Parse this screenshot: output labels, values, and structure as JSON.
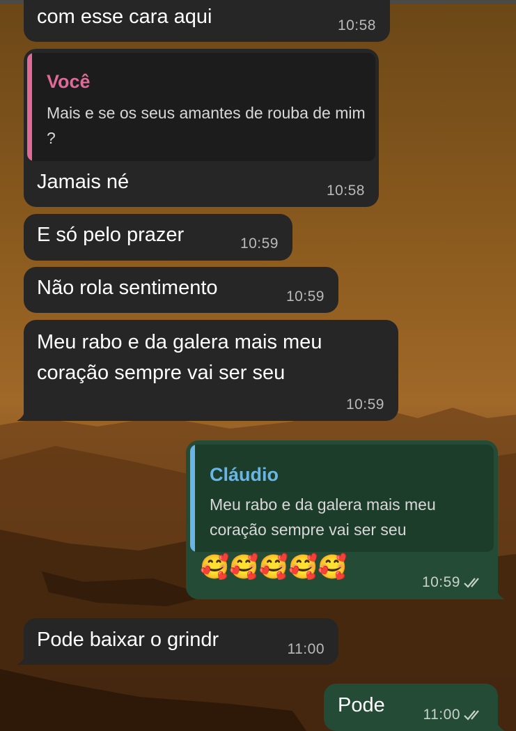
{
  "colors": {
    "incoming_bubble": "#262626",
    "outgoing_bubble": "#234b35",
    "quote_you_accent": "#e06a97",
    "quote_claudio_accent": "#69b6e6"
  },
  "messages": [
    {
      "text": "com esse cara aqui",
      "time": "10:58"
    },
    {
      "reply_to": {
        "name": "Você",
        "text": "Mais e se os seus amantes de rouba de mim ?"
      },
      "text": "Jamais né",
      "time": "10:58"
    },
    {
      "text": "E só pelo prazer",
      "time": "10:59"
    },
    {
      "text": "Não rola sentimento",
      "time": "10:59"
    },
    {
      "text": "Meu rabo e da galera mais meu coração sempre vai ser seu",
      "time": "10:59"
    },
    {
      "reply_to": {
        "name": "Cláudio",
        "text": "Meu rabo e da galera mais meu coração sempre vai ser seu"
      },
      "text": "🥰🥰🥰🥰🥰",
      "time": "10:59",
      "status": "read-double-check-icon"
    },
    {
      "text": "Pode baixar o grindr",
      "time": "11:00"
    },
    {
      "text": "Pode",
      "time": "11:00",
      "status": "read-double-check-icon"
    }
  ]
}
